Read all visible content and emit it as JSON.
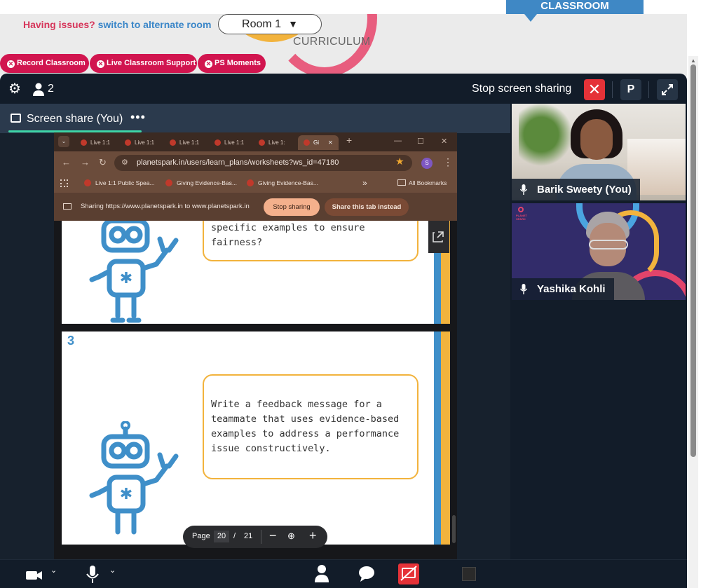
{
  "portal": {
    "issues_text": "Having issues?",
    "alternate_link": "switch to alternate room",
    "room_select": "Room 1",
    "classroom_tab": "CLASSROOM",
    "curriculum": "CURRICULUM",
    "pills": [
      "Record Classroom",
      "Live Classroom Support",
      "PS Moments"
    ],
    "colors": {
      "brand_pink": "#d1154f",
      "accent_blue": "#3f88c5"
    }
  },
  "meeting": {
    "participant_count": "2",
    "stop_sharing_label": "Stop screen sharing",
    "presenter_button": "P",
    "screen_share_label": "Screen share (You)",
    "more_menu": "•••"
  },
  "browser": {
    "tabs": [
      "Live 1:1",
      "Live 1:1",
      "Live 1:1",
      "Live 1:1",
      "Live 1:",
      "Gi"
    ],
    "url": "planetspark.in/users/learn_plans/worksheets?ws_id=47180",
    "profile_initial": "S",
    "bookmarks": [
      "Live 1:1 Public Spea...",
      "Giving Evidence-Bas...",
      "Giving Evidence-Bas..."
    ],
    "bookmarks_more": "»",
    "all_bookmarks": "All Bookmarks",
    "sharing_notice": "Sharing https://www.planetspark.in to www.planetspark.in",
    "stop_sharing_btn": "Stop sharing",
    "share_tab_btn": "Share this tab instead"
  },
  "document": {
    "card1_text": [
      "specific examples to ensure",
      "fairness?"
    ],
    "card2_number": "3",
    "card2_text": [
      "Write a feedback message for a",
      "teammate that uses evidence-based",
      "examples to address a performance",
      "issue constructively."
    ],
    "pager": {
      "label": "Page",
      "current": "20",
      "separator": "/",
      "total": "21",
      "zoom_out": "−",
      "zoom_in": "+"
    }
  },
  "participants": [
    {
      "name": "Barik Sweety (You)"
    },
    {
      "name": "Yashika Kohli",
      "logo_text": "PLANET SPARK"
    }
  ],
  "toolbar": {
    "icons": [
      "camera-icon",
      "microphone-icon",
      "participants-icon",
      "chat-icon",
      "screen-share-off-icon"
    ]
  }
}
